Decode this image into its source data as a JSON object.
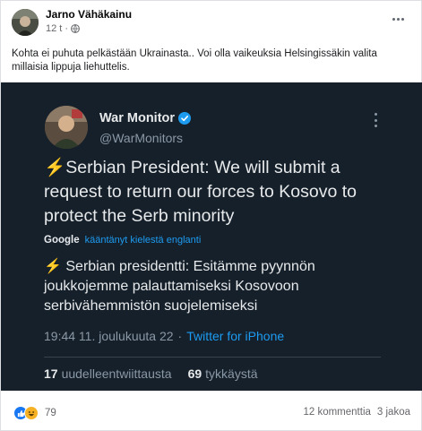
{
  "post": {
    "author": "Jarno Vähäkainu",
    "time": "12 t",
    "separator": "·",
    "text": "Kohta ei puhuta pelkästään Ukrainasta.. Voi olla vaikeuksia Helsingissäkin valita millaisia lippuja liehuttelis."
  },
  "tweet": {
    "display_name": "War Monitor",
    "handle": "@WarMonitors",
    "bolt": "⚡",
    "main_text": "Serbian President: We will submit a request to return our forces to Kosovo to protect the Serb minority",
    "google_label": "Google",
    "translated_by": "kääntänyt kielestä englanti",
    "translated_text": "Serbian presidentti: Esitämme pyynnön joukkojemme palauttamiseksi Kosovoon serbivähemmistön suojelemiseksi",
    "timestamp": "19:44 11. joulukuuta 22",
    "dot": "·",
    "source": "Twitter for iPhone",
    "retweets_count": "17",
    "retweets_label": "uudelleentwiittausta",
    "likes_count": "69",
    "likes_label": "tykkäystä"
  },
  "footer": {
    "reaction_count": "79",
    "comments": "12 kommenttia",
    "shares": "3 jakoa"
  },
  "colors": {
    "tweet_background": "#15202b",
    "link_blue": "#1d9bf0",
    "facebook_blue": "#1877f2"
  }
}
